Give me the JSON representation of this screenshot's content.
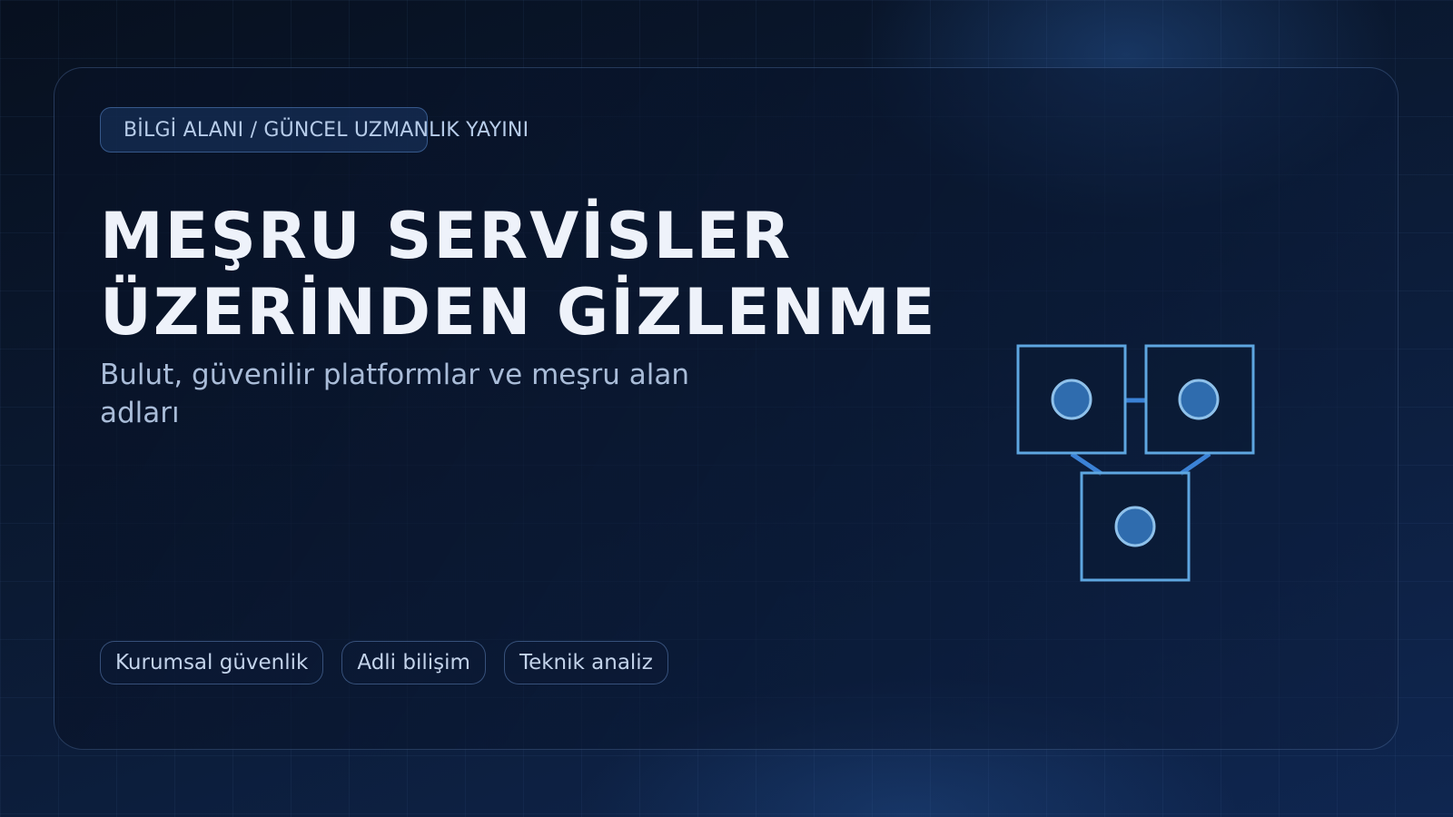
{
  "kicker": "BİLGİ ALANI / GÜNCEL UZMANLIK YAYINI",
  "title": {
    "line1": "MEŞRU SERVİSLER",
    "line2": "ÜZERİNDEN GİZLENME"
  },
  "subtitle": "Bulut, güvenilir platformlar ve meşru alan adları",
  "tags": [
    "Kurumsal güvenlik",
    "Adli bilişim",
    "Teknik analiz"
  ],
  "colors": {
    "accent": "#3b82d6",
    "node_stroke": "#5ea6e0",
    "node_fill": "#2f6cae",
    "background": "#0b1a33"
  },
  "icons": [
    "network-nodes-icon"
  ]
}
